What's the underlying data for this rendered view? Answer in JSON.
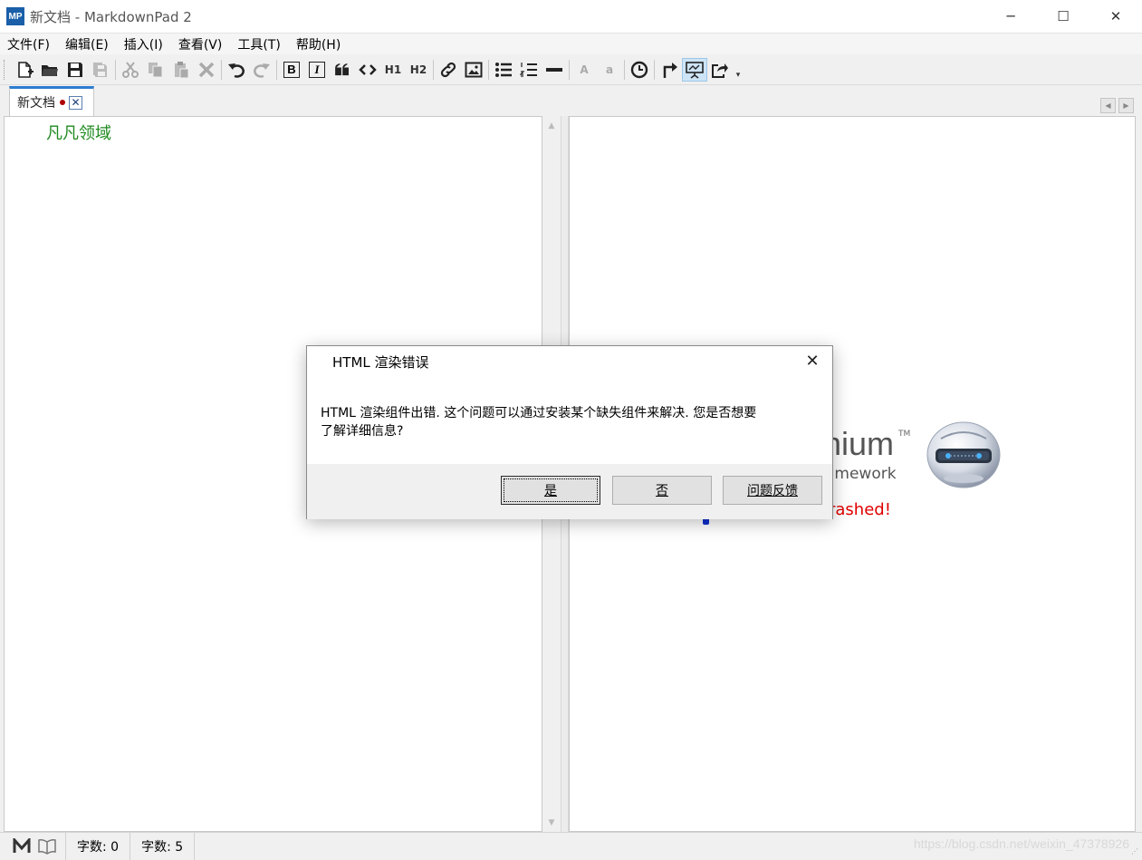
{
  "window": {
    "logo_text": "MP",
    "title": "新文档 - MarkdownPad 2",
    "minimize_glyph": "─",
    "maximize_glyph": "☐",
    "close_glyph": "✕"
  },
  "menu": {
    "items": [
      "文件(F)",
      "编辑(E)",
      "插入(I)",
      "查看(V)",
      "工具(T)",
      "帮助(H)"
    ]
  },
  "toolbar": {
    "icons": [
      "new-document-icon",
      "open-folder-icon",
      "save-icon",
      "save-all-icon",
      "cut-icon",
      "copy-icon",
      "paste-icon",
      "delete-icon",
      "undo-icon",
      "redo-icon",
      "bold-icon",
      "italic-icon",
      "quote-icon",
      "code-icon",
      "h1-icon",
      "h2-icon",
      "link-icon",
      "image-icon",
      "bullet-list-icon",
      "numbered-list-icon",
      "horizontal-rule-icon",
      "uppercase-icon",
      "lowercase-icon",
      "timestamp-icon",
      "export-icon",
      "live-preview-icon",
      "share-icon"
    ],
    "h1_label": "H1",
    "h2_label": "H2",
    "upper_label": "A",
    "lower_label": "a",
    "bold_label": "B",
    "italic_label": "I"
  },
  "tab": {
    "label": "新文档",
    "close_glyph": "✕"
  },
  "editor": {
    "content": "凡凡领域"
  },
  "preview": {
    "brand_fragment": "nium",
    "tm": "TM",
    "framework_fragment": "amework",
    "crash_fragment": "rashed!"
  },
  "dialog": {
    "title": "HTML 渲染错误",
    "message_line1": "HTML 渲染组件出错. 这个问题可以通过安装某个缺失组件来解决. 您是否想要",
    "message_line2": "了解详细信息?",
    "buttons": {
      "yes": "是",
      "no": "否",
      "feedback": "问题反馈"
    },
    "close_glyph": "✕"
  },
  "statusbar": {
    "word_count": "字数: 0",
    "char_count": "字数:  5",
    "watermark": "https://blog.csdn.net/weixin_47378926"
  },
  "colors": {
    "accent": "#2d7bd1",
    "editor_text": "#1e8a1e",
    "crash_text": "#e00000"
  }
}
